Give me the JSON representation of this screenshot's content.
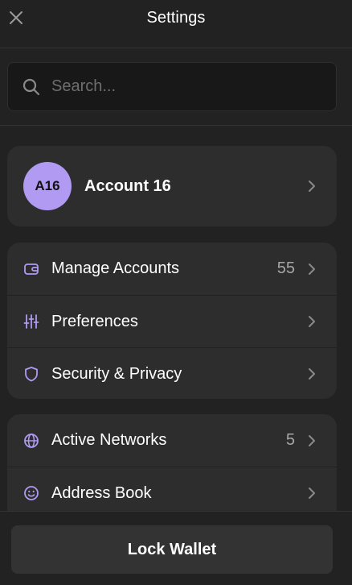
{
  "header": {
    "title": "Settings",
    "close_icon": "close-icon"
  },
  "search": {
    "placeholder": "Search...",
    "value": "",
    "icon": "search-icon"
  },
  "account": {
    "initials": "A16",
    "name": "Account 16"
  },
  "groups": [
    {
      "items": [
        {
          "label": "Manage Accounts",
          "count": "55",
          "icon": "wallet-icon"
        },
        {
          "label": "Preferences",
          "count": "",
          "icon": "sliders-icon"
        },
        {
          "label": "Security & Privacy",
          "count": "",
          "icon": "shield-icon"
        }
      ]
    },
    {
      "items": [
        {
          "label": "Active Networks",
          "count": "5",
          "icon": "globe-icon"
        },
        {
          "label": "Address Book",
          "count": "",
          "icon": "smiley-icon"
        }
      ]
    }
  ],
  "footer": {
    "lock_label": "Lock Wallet"
  },
  "colors": {
    "background": "#222222",
    "card": "#2d2d2d",
    "accent": "#b09af2",
    "muted_text": "#a6a6a6"
  }
}
